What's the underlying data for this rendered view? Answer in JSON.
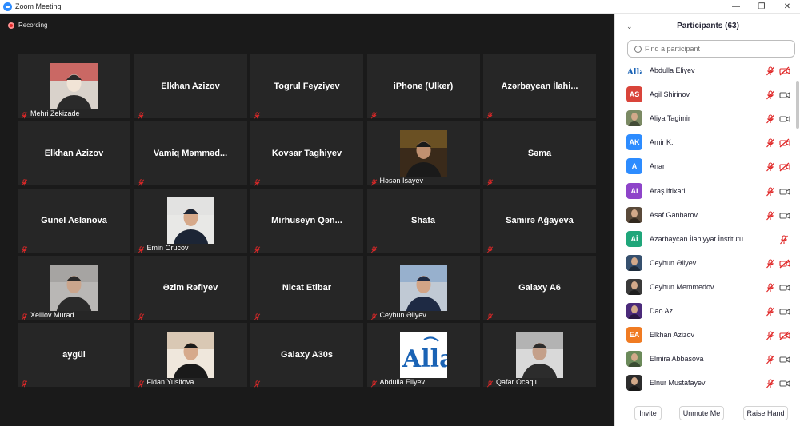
{
  "window": {
    "title": "Zoom Meeting",
    "controls": [
      "—",
      "❐",
      "✕"
    ]
  },
  "recording": {
    "label": "Recording"
  },
  "grid": {
    "tiles": [
      {
        "name": "",
        "label": "Mehri Zekizade",
        "photo": "woman-hijab-red"
      },
      {
        "name": "Elkhan Azizov",
        "label": ""
      },
      {
        "name": "Togrul Feyziyev",
        "label": ""
      },
      {
        "name": "iPhone (Ulker)",
        "label": ""
      },
      {
        "name": "Azərbaycan İlahi...",
        "label": ""
      },
      {
        "name": "Elkhan Azizov",
        "label": ""
      },
      {
        "name": "Vamiq Məmməd...",
        "label": ""
      },
      {
        "name": "Kovsar Taghiyev",
        "label": ""
      },
      {
        "name": "",
        "label": "Həsən İsayev",
        "photo": "man-mosque"
      },
      {
        "name": "Səma",
        "label": ""
      },
      {
        "name": "Gunel Aslanova",
        "label": ""
      },
      {
        "name": "",
        "label": "Emin Orucov",
        "photo": "man-suit"
      },
      {
        "name": "Mirhuseyn Qən...",
        "label": ""
      },
      {
        "name": "Shafa",
        "label": ""
      },
      {
        "name": "Samirə Ağayeva",
        "label": ""
      },
      {
        "name": "",
        "label": "Xelilov Murad",
        "photo": "young-man"
      },
      {
        "name": "Əzim Rəfiyev",
        "label": ""
      },
      {
        "name": "Nicat Etibar",
        "label": ""
      },
      {
        "name": "",
        "label": "Ceyhun Əliyev",
        "photo": "man-glasses"
      },
      {
        "name": "Galaxy A6",
        "label": ""
      },
      {
        "name": "aygül",
        "label": ""
      },
      {
        "name": "",
        "label": "Fidan Yusifova",
        "photo": "woman-standing"
      },
      {
        "name": "Galaxy A30s",
        "label": ""
      },
      {
        "name": "",
        "label": "Abdulla Eliyev",
        "photo": "allah-calligraphy"
      },
      {
        "name": "",
        "label": "Qafar Ocaqlı",
        "photo": "man-street"
      }
    ]
  },
  "participants": {
    "title": "Participants (63)",
    "search_placeholder": "Find a participant",
    "items": [
      {
        "name": "Abdulla Eliyev",
        "initials": "",
        "avatar_color": "#ffffff",
        "avatar_kind": "calligraphy",
        "mic": "muted",
        "cam": "off"
      },
      {
        "name": "Agil Shirinov",
        "initials": "AS",
        "avatar_color": "#d9443a",
        "mic": "muted",
        "cam": "on"
      },
      {
        "name": "Aliya Tagimir",
        "initials": "",
        "avatar_color": "#7b8a64",
        "avatar_kind": "photo",
        "mic": "muted",
        "cam": "on"
      },
      {
        "name": "Amir K.",
        "initials": "AK",
        "avatar_color": "#2d8cff",
        "mic": "muted",
        "cam": "off"
      },
      {
        "name": "Anar",
        "initials": "A",
        "avatar_color": "#2d8cff",
        "mic": "muted",
        "cam": "off"
      },
      {
        "name": "Araş iftixari",
        "initials": "AI",
        "avatar_color": "#8e44c9",
        "mic": "muted",
        "cam": "on"
      },
      {
        "name": "Asaf Ganbarov",
        "initials": "",
        "avatar_color": "#5a4a3a",
        "avatar_kind": "photo",
        "mic": "muted",
        "cam": "on"
      },
      {
        "name": "Azərbaycan İlahiyyat İnstitutu",
        "initials": "Aİ",
        "avatar_color": "#1fa67a",
        "mic": "muted",
        "cam": "none"
      },
      {
        "name": "Ceyhun Əliyev",
        "initials": "",
        "avatar_color": "#36506e",
        "avatar_kind": "photo",
        "mic": "muted",
        "cam": "off"
      },
      {
        "name": "Ceyhun Memmedov",
        "initials": "",
        "avatar_color": "#3a3a3a",
        "avatar_kind": "photo",
        "mic": "muted",
        "cam": "on"
      },
      {
        "name": "Dao Az",
        "initials": "",
        "avatar_color": "#4b2a7a",
        "avatar_kind": "photo",
        "mic": "muted",
        "cam": "on"
      },
      {
        "name": "Elkhan Azizov",
        "initials": "EA",
        "avatar_color": "#f07b22",
        "mic": "muted",
        "cam": "off"
      },
      {
        "name": "Elmira Abbasova",
        "initials": "",
        "avatar_color": "#6b8a5a",
        "avatar_kind": "photo",
        "mic": "muted",
        "cam": "on"
      },
      {
        "name": "Elnur Mustafayev",
        "initials": "",
        "avatar_color": "#2c2c2c",
        "avatar_kind": "photo",
        "mic": "muted",
        "cam": "on"
      }
    ]
  },
  "footer": {
    "invite": "Invite",
    "unmute": "Unmute Me",
    "raise_hand": "Raise Hand"
  },
  "colors": {
    "muted_red": "#e02828",
    "tile_bg": "#262626",
    "stage_bg": "#1a1a1a",
    "accent": "#2d8cff"
  }
}
